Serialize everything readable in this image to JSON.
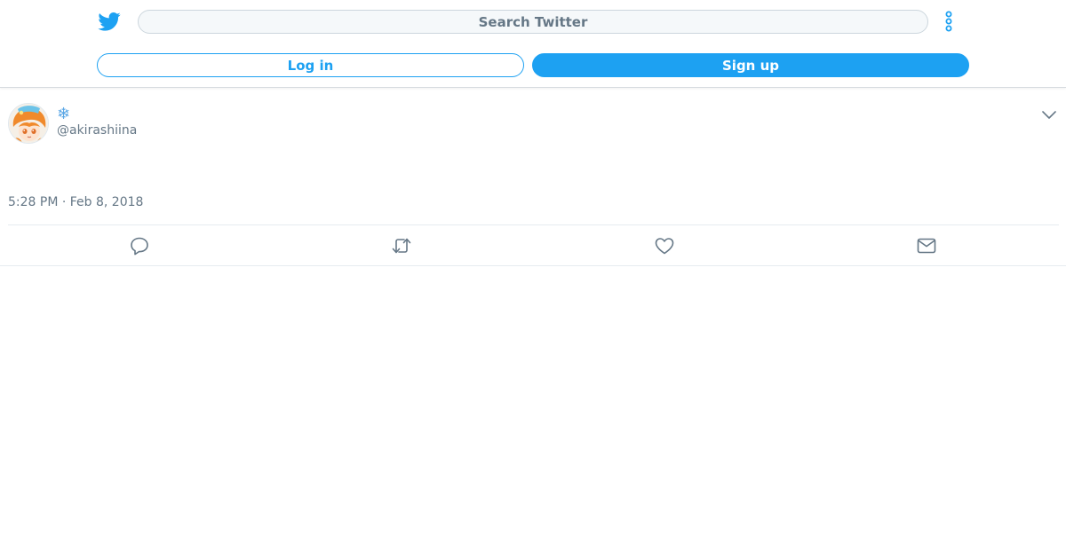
{
  "header": {
    "logo_icon": "twitter-bird-icon",
    "search": {
      "placeholder": "Search Twitter"
    },
    "more_icon": "more-vertical-icon",
    "login_label": "Log in",
    "signup_label": "Sign up"
  },
  "tweet": {
    "display_name": "❄",
    "handle": "@akirashiina",
    "timestamp": "5:28 PM · Feb 8, 2018",
    "actions": [
      {
        "name": "reply",
        "icon": "reply-icon"
      },
      {
        "name": "retweet",
        "icon": "retweet-icon"
      },
      {
        "name": "like",
        "icon": "heart-icon"
      },
      {
        "name": "direct-message",
        "icon": "envelope-icon"
      }
    ]
  },
  "colors": {
    "brand": "#1da1f2",
    "secondary_text": "#657786",
    "border": "#e6ecf0"
  }
}
